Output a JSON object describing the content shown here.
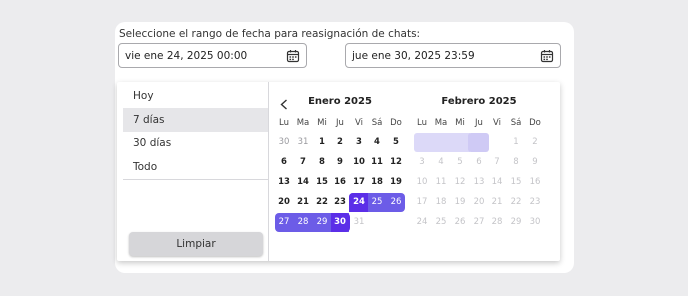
{
  "prompt": "Seleccione el rango de fecha para reasignación de chats:",
  "start_input": {
    "value": "vie ene 24, 2025 00:00",
    "icon": "calendar-icon"
  },
  "end_input": {
    "value": "jue ene 30, 2025 23:59",
    "icon": "calendar-icon"
  },
  "presets": [
    {
      "label": "Hoy",
      "active": false
    },
    {
      "label": "7 días",
      "active": true
    },
    {
      "label": "30 días",
      "active": false
    },
    {
      "label": "Todo",
      "active": false
    }
  ],
  "clear_label": "Limpiar",
  "colors": {
    "range_light": "#dcd9f8",
    "range_strong": "#6c5ce7",
    "range_deep": "#5b2ee8"
  },
  "calendars": [
    {
      "title": "Enero 2025",
      "weekdays": [
        "Lu",
        "Ma",
        "Mi",
        "Ju",
        "Vi",
        "Sá",
        "Do"
      ],
      "weeks": [
        [
          "30",
          "31",
          "1",
          "2",
          "3",
          "4",
          "5"
        ],
        [
          "6",
          "7",
          "8",
          "9",
          "10",
          "11",
          "12"
        ],
        [
          "13",
          "14",
          "15",
          "16",
          "17",
          "18",
          "19"
        ],
        [
          "20",
          "21",
          "22",
          "23",
          "24",
          "25",
          "26"
        ],
        [
          "27",
          "28",
          "29",
          "30",
          "31",
          "",
          ""
        ]
      ],
      "range_start": "24",
      "range_end": "30"
    },
    {
      "title": "Febrero 2025",
      "weekdays": [
        "Lu",
        "Ma",
        "Mi",
        "Ju",
        "Vi",
        "Sá",
        "Do"
      ],
      "weeks": [
        [
          "",
          "",
          "",
          "",
          "",
          "1",
          "2"
        ],
        [
          "3",
          "4",
          "5",
          "6",
          "7",
          "8",
          "9"
        ],
        [
          "10",
          "11",
          "12",
          "13",
          "14",
          "15",
          "16"
        ],
        [
          "17",
          "18",
          "19",
          "20",
          "21",
          "22",
          "23"
        ],
        [
          "24",
          "25",
          "26",
          "27",
          "28",
          "29",
          "30"
        ]
      ]
    }
  ]
}
